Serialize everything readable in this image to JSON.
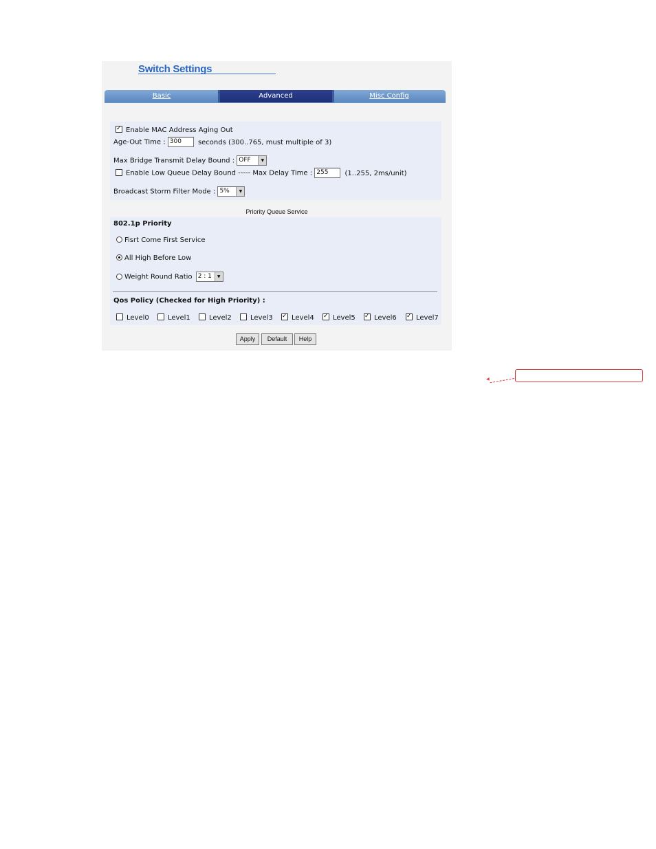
{
  "header": {
    "title": "Switch Settings"
  },
  "tabs": [
    {
      "label": "Basic",
      "active": false
    },
    {
      "label": "Advanced",
      "active": true
    },
    {
      "label": "Misc Config",
      "active": false
    }
  ],
  "advanced": {
    "mac_aging": {
      "label": "Enable MAC Address Aging Out",
      "checked": true
    },
    "age_out": {
      "label": "Age-Out Time :",
      "value": "300",
      "hint": "seconds (300..765, must multiple of 3)"
    },
    "max_bridge": {
      "label": "Max Bridge Transmit Delay Bound :",
      "value": "OFF"
    },
    "low_queue": {
      "label": "Enable Low Queue Delay Bound ----- Max Delay Time :",
      "checked": false,
      "value": "255",
      "hint": "(1..255, 2ms/unit)"
    },
    "storm": {
      "label": "Broadcast Storm Filter Mode :",
      "value": "5%"
    }
  },
  "priority": {
    "section_label": "Priority Queue Service",
    "heading": "802.1p Priority",
    "options": [
      {
        "label": "Fisrt Come First Service",
        "selected": false
      },
      {
        "label": "All High Before Low",
        "selected": true
      },
      {
        "label": "Weight Round Ratio",
        "selected": false,
        "value": "2 : 1"
      }
    ]
  },
  "qos": {
    "heading": "Qos Policy (Checked for High Priority) :",
    "levels": [
      {
        "label": "Level0",
        "checked": false
      },
      {
        "label": "Level1",
        "checked": false
      },
      {
        "label": "Level2",
        "checked": false
      },
      {
        "label": "Level3",
        "checked": false
      },
      {
        "label": "Level4",
        "checked": true
      },
      {
        "label": "Level5",
        "checked": true
      },
      {
        "label": "Level6",
        "checked": true
      },
      {
        "label": "Level7",
        "checked": true
      }
    ]
  },
  "buttons": {
    "apply": "Apply",
    "default": "Default",
    "help": "Help"
  },
  "colors": {
    "accent": "#2b66c4",
    "tab_active": "#1f2f78",
    "tab_inactive": "#6d97cb",
    "panel": "#e8edf7",
    "callout": "#e03a3a"
  }
}
